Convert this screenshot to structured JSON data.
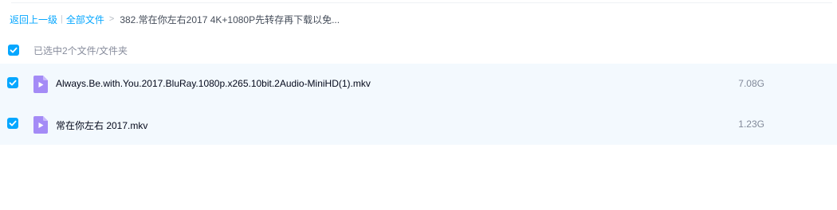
{
  "breadcrumb": {
    "back": "返回上一级",
    "separator": "|",
    "root": "全部文件",
    "chevron": ">",
    "current": "382.常在你左右2017 4K+1080P先转存再下载以免..."
  },
  "selection": {
    "count_text": "已选中2个文件/文件夹",
    "all_checked": true
  },
  "files": [
    {
      "name": "Always.Be.with.You.2017.BluRay.1080p.x265.10bit.2Audio-MiniHD(1).mkv",
      "size": "7.08G",
      "checked": true,
      "icon": "video-file-icon"
    },
    {
      "name": "常在你左右 2017.mkv",
      "size": "1.23G",
      "checked": true,
      "icon": "video-file-icon"
    }
  ],
  "colors": {
    "accent": "#06a7ff",
    "row_selected_bg": "#f3f9fe",
    "video_icon": "#a48bf6"
  }
}
